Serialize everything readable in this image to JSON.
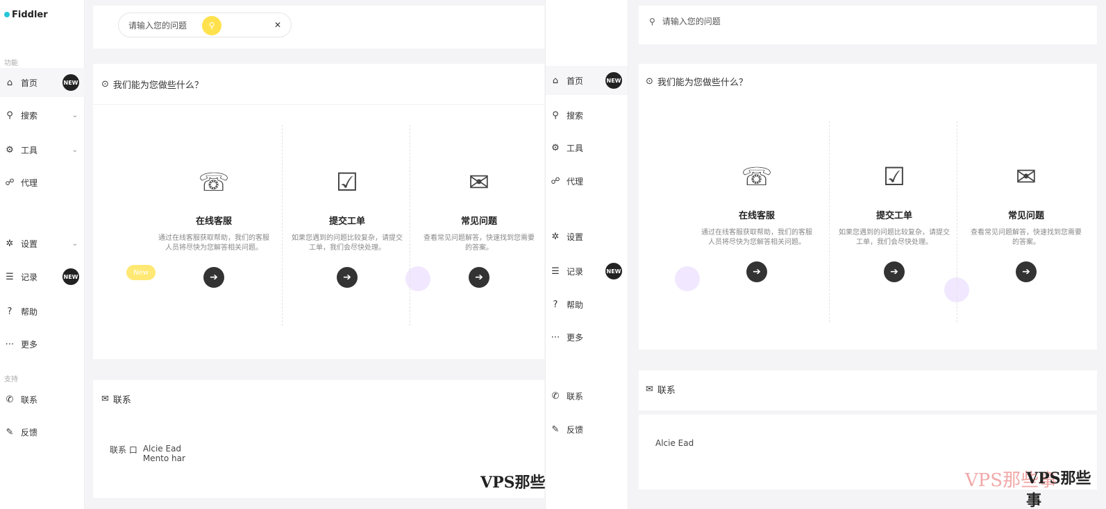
{
  "sidebar": {
    "logo": "Fiddler",
    "section_main": "功能",
    "section_bottom": "支持",
    "items": [
      {
        "label": "首页",
        "icon": "home-icon",
        "badge": "NEW"
      },
      {
        "label": "搜索",
        "icon": "search-icon"
      },
      {
        "label": "工具",
        "icon": "tool-icon"
      },
      {
        "label": "代理",
        "icon": "proxy-icon"
      },
      {
        "label": "设置",
        "icon": "gear-icon"
      },
      {
        "label": "记录",
        "icon": "log-icon",
        "badge": "NEW"
      },
      {
        "label": "帮助",
        "icon": "help-icon"
      },
      {
        "label": "更多",
        "icon": "more-icon"
      },
      {
        "label": "联系",
        "icon": "contact-icon"
      },
      {
        "label": "反馈",
        "icon": "feedback-icon"
      }
    ]
  },
  "search": {
    "placeholder": "请输入您的问题",
    "button_icon": "search-icon",
    "clear_icon": "close-icon"
  },
  "help_section": {
    "title": "我们能为您做些什么？"
  },
  "cards": [
    {
      "name": "在线客服",
      "icon": "headset-icon",
      "desc": "通过在线客服获取帮助，我们的客服人员将尽快为您解答相关问题。",
      "go": "go-icon"
    },
    {
      "name": "提交工单",
      "icon": "ticket-icon",
      "desc": "如果您遇到的问题比较复杂，请提交工单，我们会尽快处理。",
      "go": "go-icon"
    },
    {
      "name": "常见问题",
      "icon": "faq-icon",
      "desc": "查看常见问题解答，快速找到您需要的答案。",
      "go": "go-icon"
    }
  ],
  "pill_label": "New",
  "contact_section": {
    "title": "联系",
    "line1": "Alcie Ead",
    "line2": "Mento har",
    "prefix": "联系 口"
  },
  "right": {
    "search_text": "请输入您的问题",
    "help_title": "我们能为您做些什么？",
    "contact_title": "联系",
    "contact_line": "Alcie Ead",
    "brand": "VPS那些事",
    "watermark": "VPS那些事"
  },
  "footer_brand": "VPS那些事",
  "colors": {
    "accent_yellow": "#ffe14d",
    "accent_purple": "#f1e8ff",
    "accent_cyan": "#26c6da"
  }
}
